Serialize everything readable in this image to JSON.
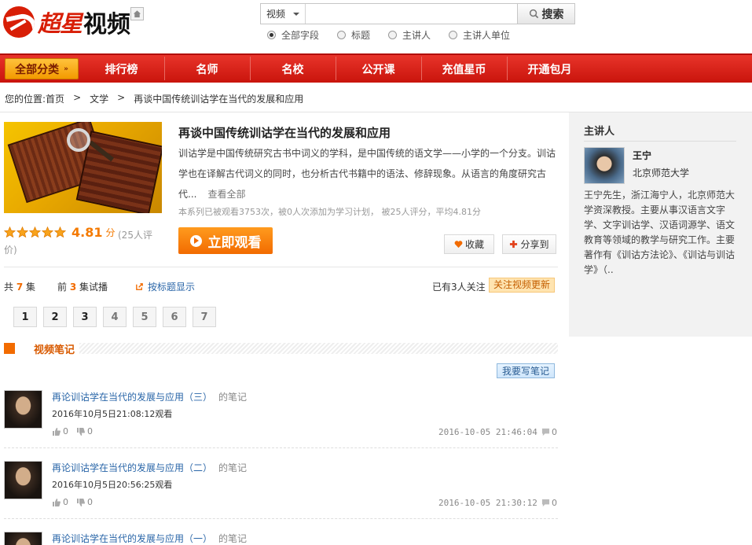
{
  "brand": {
    "logo_cn": "超星",
    "logo_suffix": "视频"
  },
  "search": {
    "type_selected": "视频",
    "placeholder": "",
    "button_label": "搜索",
    "options": [
      {
        "label": "全部字段",
        "checked": true
      },
      {
        "label": "标题",
        "checked": false
      },
      {
        "label": "主讲人",
        "checked": false
      },
      {
        "label": "主讲人单位",
        "checked": false
      }
    ]
  },
  "nav": {
    "all_label": "全部分类",
    "items": [
      "排行榜",
      "名师",
      "名校",
      "公开课",
      "充值星币",
      "开通包月"
    ]
  },
  "breadcrumb": {
    "prefix": "您的位置:",
    "home": "首页",
    "sep": ">",
    "category": "文学",
    "current": "再谈中国传统训诂学在当代的发展和应用"
  },
  "video": {
    "title": "再谈中国传统训诂学在当代的发展和应用",
    "description": "训诂学是中国传统研究古书中词义的学科，是中国传统的语文学——小学的一个分支。训诂学也在译解古代词义的同时，也分析古代书籍中的语法、修辞现象。从语言的角度研究古代...",
    "more_label": "查看全部",
    "stats": "本系列已被观看3753次，被0人次添加为学习计划，  被25人评分，平均4.81分",
    "rating": 4.81,
    "rating_stars": 5,
    "rating_unit": "分",
    "rating_count": "(25人评价)",
    "watch_label": "立即观看",
    "fav_label": "收藏",
    "share_label": "分享到"
  },
  "episodes": {
    "total_prefix": "共",
    "total": "7",
    "total_suffix": "集",
    "trial_prefix": "前",
    "trial": "3",
    "trial_suffix": "集试播",
    "toggle_label": "按标题显示",
    "followers": "已有3人关注",
    "follow_label": "关注视频更新",
    "pages": [
      "1",
      "2",
      "3",
      "4",
      "5",
      "6",
      "7"
    ]
  },
  "notes": {
    "section_title": "视频笔记",
    "write_label": "我要写笔记",
    "suffix": "的笔记",
    "items": [
      {
        "title": "再论训诂学在当代的发展与应用（三）",
        "watched": "2016年10月5日21:08:12观看",
        "likes": "0",
        "dislikes": "0",
        "date": "2016-10-05 21:46:04",
        "comments": "0"
      },
      {
        "title": "再论训诂学在当代的发展与应用（二）",
        "watched": "2016年10月5日20:56:25观看",
        "likes": "0",
        "dislikes": "0",
        "date": "2016-10-05 21:30:12",
        "comments": "0"
      },
      {
        "title": "再论训诂学在当代的发展与应用（一）",
        "watched": "",
        "likes": "",
        "dislikes": "",
        "date": "",
        "comments": ""
      }
    ]
  },
  "speaker": {
    "section_title": "主讲人",
    "name": "王宁",
    "school": "北京师范大学",
    "bio": "王宁先生，浙江海宁人，北京师范大学资深教授。主要从事汉语言文字学、文字训诂学、汉语词源学、语文教育等领域的教学与研究工作。主要著作有《训诂方法论》、《训诂与训诂学》（.."
  },
  "colors": {
    "brand_red": "#d81e06",
    "accent_orange": "#f26b00",
    "link_blue": "#2a66a8"
  }
}
